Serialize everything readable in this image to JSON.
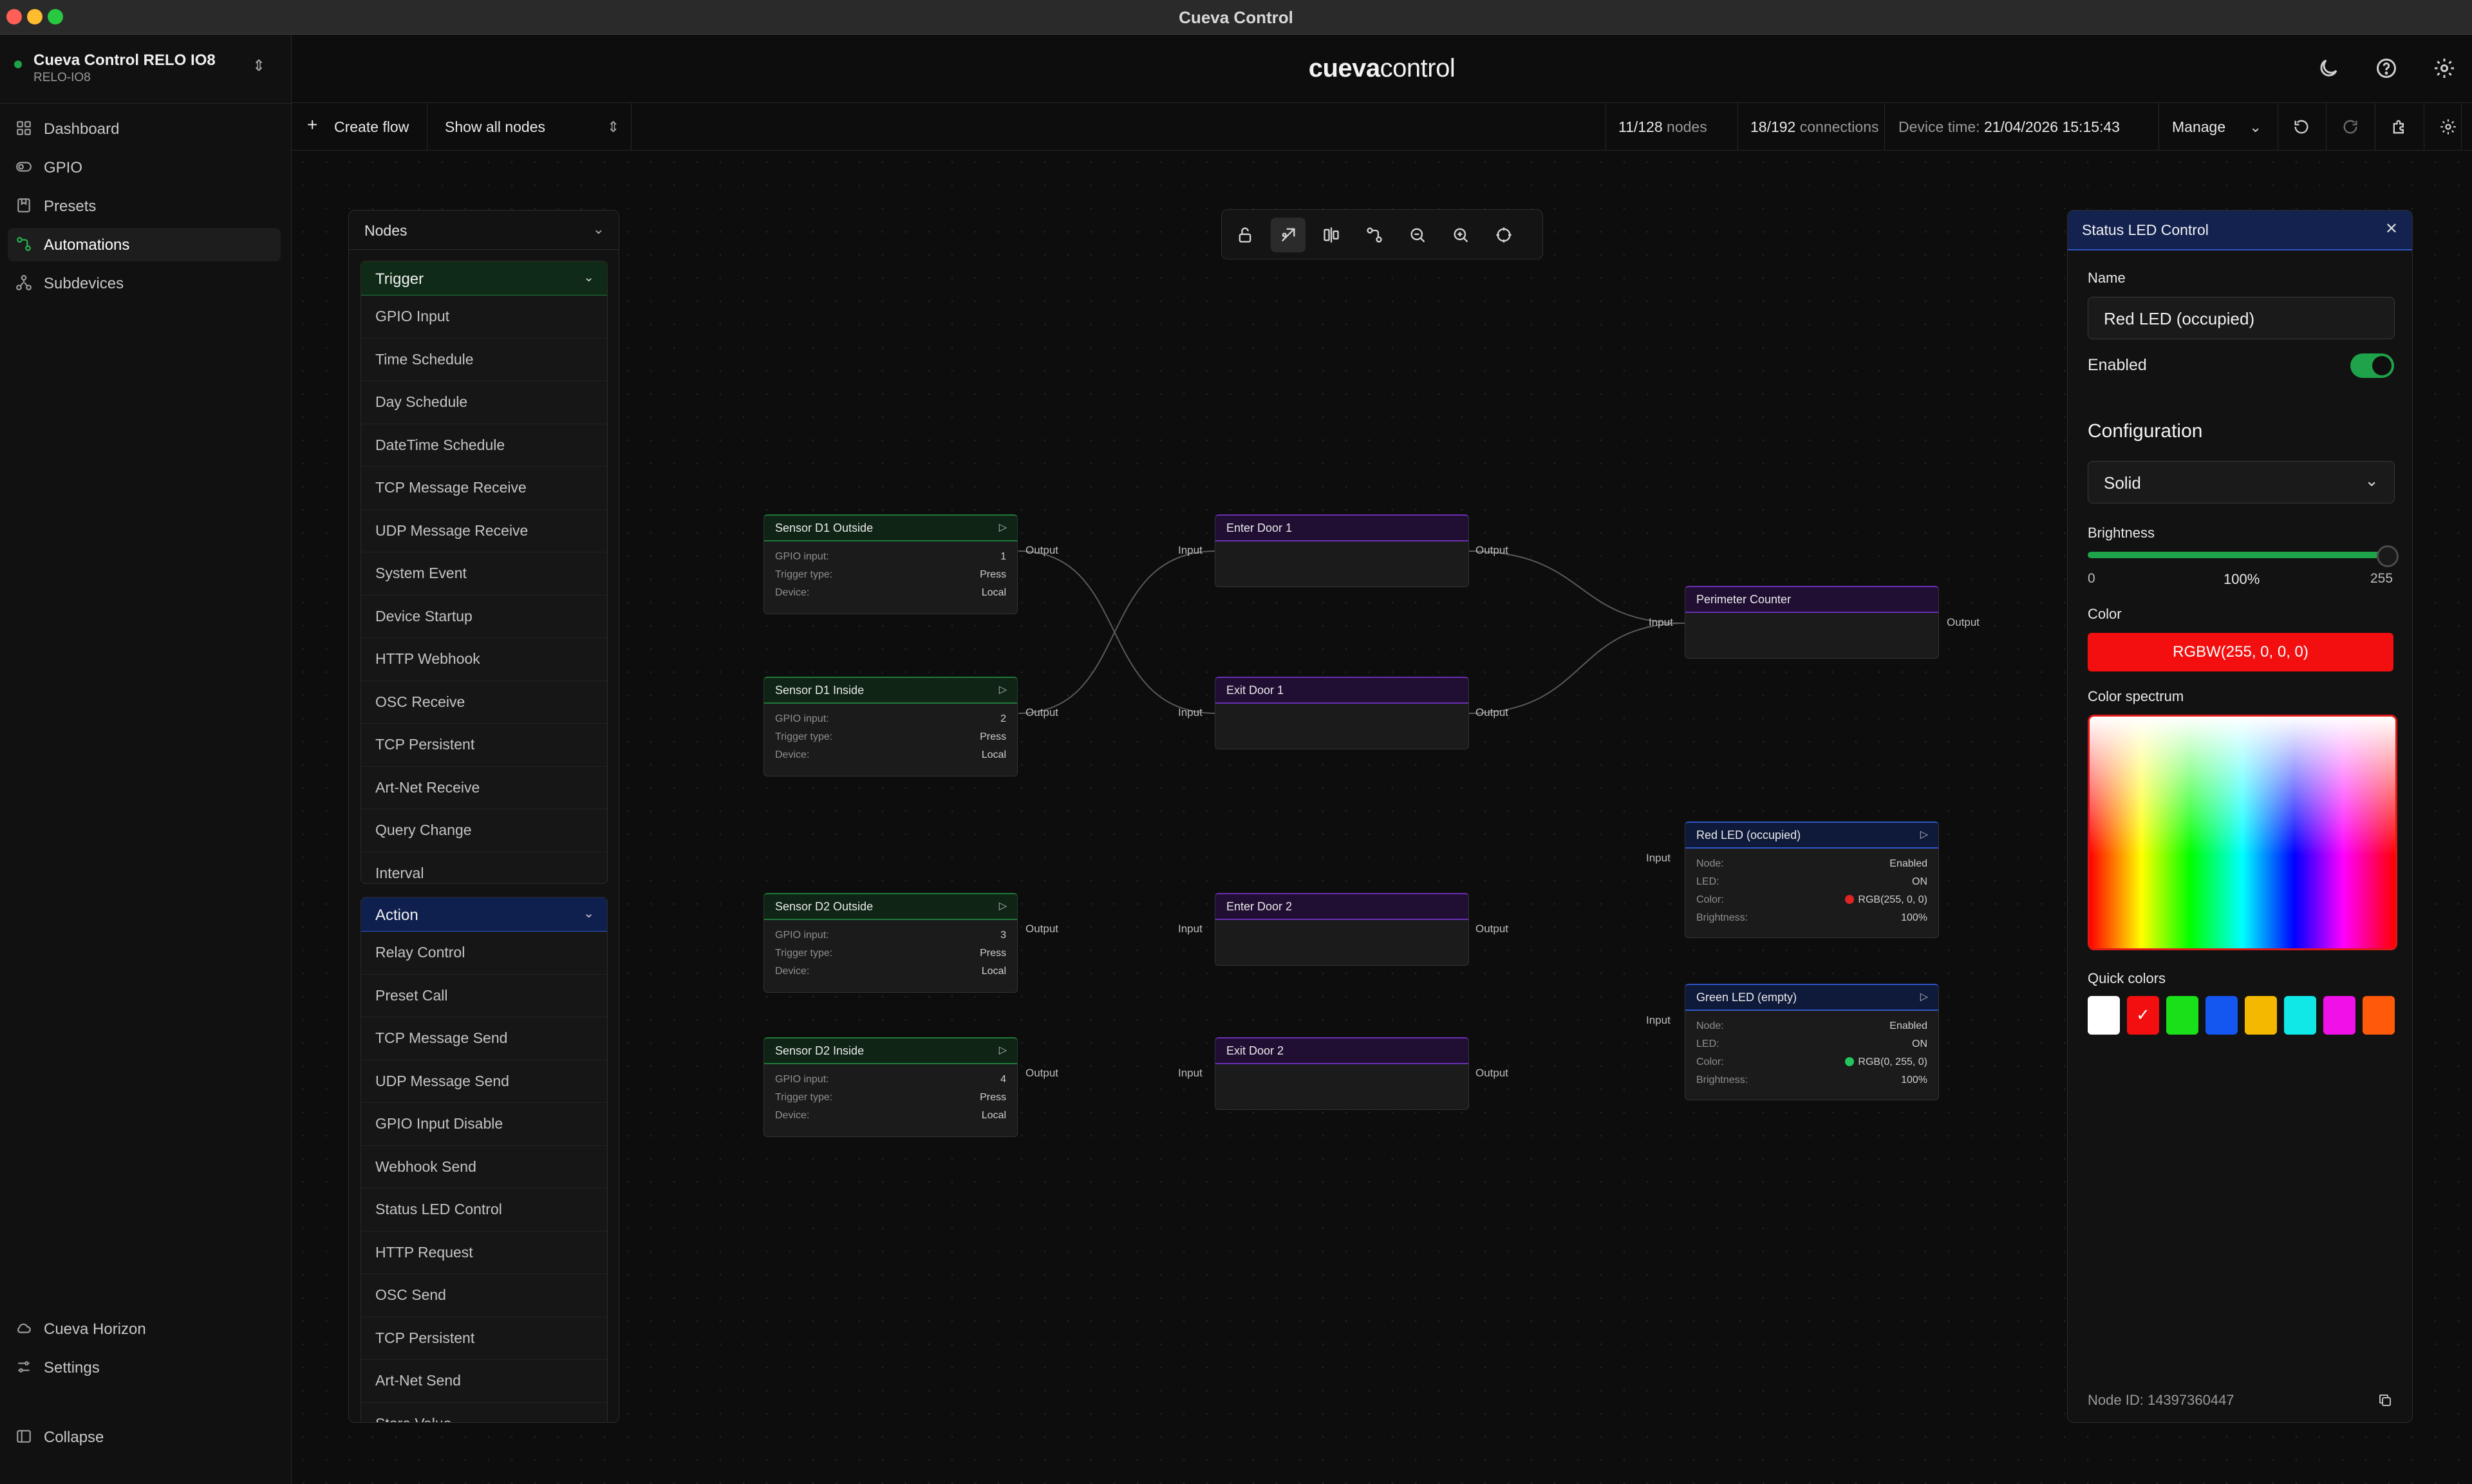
{
  "window": {
    "title": "Cueva Control"
  },
  "device": {
    "name": "Cueva Control RELO IO8",
    "id": "RELO-IO8"
  },
  "sidebar": {
    "items": [
      {
        "label": "Dashboard",
        "icon": "grid-icon"
      },
      {
        "label": "GPIO",
        "icon": "toggle-icon"
      },
      {
        "label": "Presets",
        "icon": "bookmark-icon"
      },
      {
        "label": "Automations",
        "icon": "workflow-icon",
        "active": true
      },
      {
        "label": "Subdevices",
        "icon": "network-icon"
      }
    ],
    "bottom": [
      {
        "label": "Cueva Horizon",
        "icon": "cloud-icon"
      },
      {
        "label": "Settings",
        "icon": "sliders-icon"
      },
      {
        "label": "Collapse",
        "icon": "panel-icon"
      }
    ]
  },
  "header": {
    "logo_bold": "cueva",
    "logo_light": "control"
  },
  "toolbar": {
    "create_flow": "Create flow",
    "filter": "Show all nodes",
    "nodes_count": "11/128",
    "nodes_label": "nodes",
    "connections_count": "18/192",
    "connections_label": "connections",
    "device_time_label": "Device time:",
    "device_time": "21/04/2026 15:15:43",
    "manage": "Manage"
  },
  "palette": {
    "title": "Nodes",
    "trigger": {
      "label": "Trigger",
      "items": [
        "GPIO Input",
        "Time Schedule",
        "Day Schedule",
        "DateTime Schedule",
        "TCP Message Receive",
        "UDP Message Receive",
        "System Event",
        "Device Startup",
        "HTTP Webhook",
        "OSC Receive",
        "TCP Persistent",
        "Art-Net Receive",
        "Query Change",
        "Interval"
      ]
    },
    "action": {
      "label": "Action",
      "items": [
        "Relay Control",
        "Preset Call",
        "TCP Message Send",
        "UDP Message Send",
        "GPIO Input Disable",
        "Webhook Send",
        "Status LED Control",
        "HTTP Request",
        "OSC Send",
        "TCP Persistent",
        "Art-Net Send",
        "Store Value"
      ]
    }
  },
  "flow": {
    "ports": {
      "input": "Input",
      "output": "Output"
    },
    "sensors": [
      {
        "title": "Sensor D1 Outside",
        "gpio_label": "GPIO input:",
        "gpio": "1",
        "trigger_label": "Trigger type:",
        "trigger": "Press",
        "device_label": "Device:",
        "device": "Local"
      },
      {
        "title": "Sensor D1 Inside",
        "gpio_label": "GPIO input:",
        "gpio": "2",
        "trigger_label": "Trigger type:",
        "trigger": "Press",
        "device_label": "Device:",
        "device": "Local"
      },
      {
        "title": "Sensor D2 Outside",
        "gpio_label": "GPIO input:",
        "gpio": "3",
        "trigger_label": "Trigger type:",
        "trigger": "Press",
        "device_label": "Device:",
        "device": "Local"
      },
      {
        "title": "Sensor D2 Inside",
        "gpio_label": "GPIO input:",
        "gpio": "4",
        "trigger_label": "Trigger type:",
        "trigger": "Press",
        "device_label": "Device:",
        "device": "Local"
      }
    ],
    "actions": [
      {
        "title": "Enter Door 1"
      },
      {
        "title": "Exit Door 1"
      },
      {
        "title": "Enter Door 2"
      },
      {
        "title": "Exit Door 2"
      },
      {
        "title": "Perimeter Counter"
      }
    ],
    "leds": [
      {
        "title": "Red LED (occupied)",
        "node_label": "Node:",
        "node": "Enabled",
        "led_label": "LED:",
        "led": "ON",
        "color_label": "Color:",
        "color": "RGB(255, 0, 0)",
        "swatch": "#e02424",
        "brightness_label": "Brightness:",
        "brightness": "100%"
      },
      {
        "title": "Green LED (empty)",
        "node_label": "Node:",
        "node": "Enabled",
        "led_label": "LED:",
        "led": "ON",
        "color_label": "Color:",
        "color": "RGB(0, 255, 0)",
        "swatch": "#22c55e",
        "brightness_label": "Brightness:",
        "brightness": "100%"
      }
    ]
  },
  "props": {
    "title": "Status LED Control",
    "name_label": "Name",
    "name_value": "Red LED (occupied)",
    "enabled_label": "Enabled",
    "enabled": true,
    "config_heading": "Configuration",
    "mode": "Solid",
    "brightness_label": "Brightness",
    "brightness_min": "0",
    "brightness_value": "100%",
    "brightness_max": "255",
    "color_label": "Color",
    "color_value": "RGBW(255, 0, 0, 0)",
    "spectrum_label": "Color spectrum",
    "quick_label": "Quick colors",
    "quick_colors": [
      "#ffffff",
      "#f30f0f",
      "#19e019",
      "#1456f0",
      "#f5b800",
      "#10e8e8",
      "#f010e8",
      "#ff5a0a"
    ],
    "node_id_label": "Node ID:",
    "node_id": "14397360447"
  }
}
